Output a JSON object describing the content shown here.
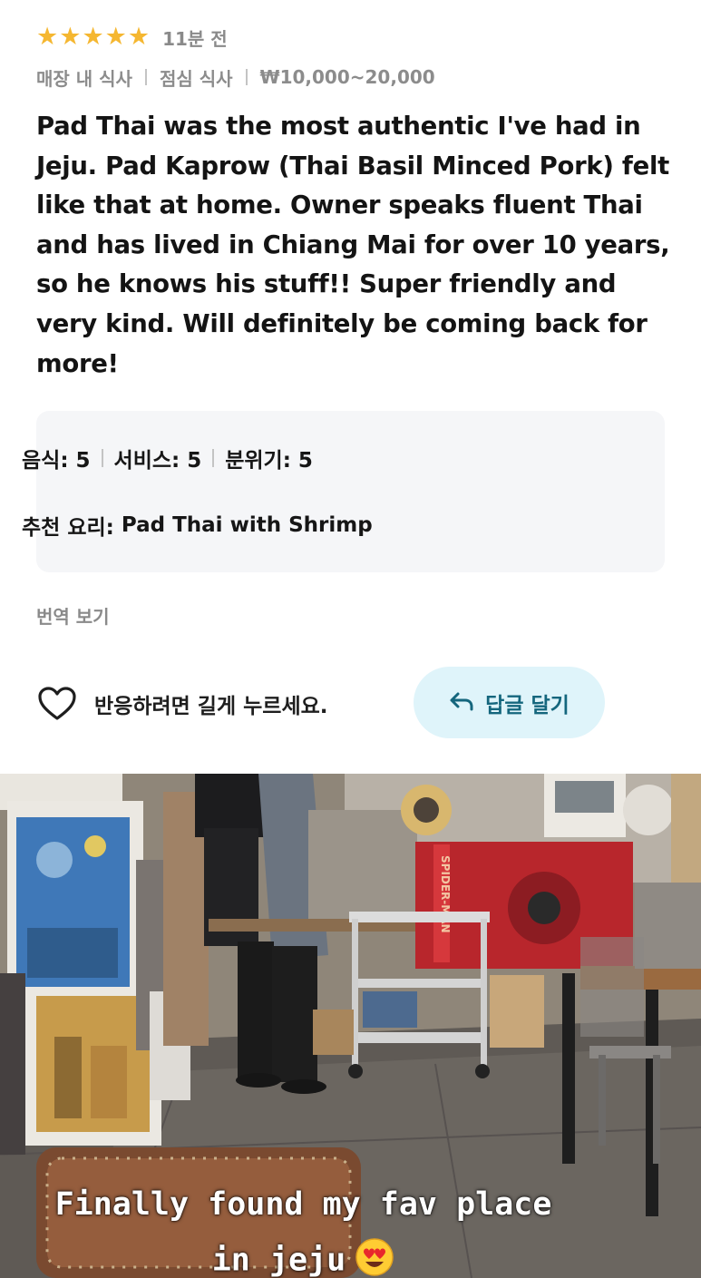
{
  "review": {
    "rating": 5,
    "rating_max": 5,
    "time_ago": "11분 전",
    "meta": {
      "dining_type": "매장 내 식사",
      "meal": "점심 식사",
      "price_range": "₩10,000~20,000"
    },
    "text": "Pad Thai was the most authentic I've had in Jeju. Pad Kaprow (Thai Basil Minced Pork) felt like that at home. Owner speaks fluent Thai and has lived in Chiang Mai for over 10 years, so he knows his stuff!! Super friendly and very kind. Will definitely be coming back for more!",
    "scores": {
      "food": "음식: 5",
      "service": "서비스: 5",
      "atmosphere": "분위기: 5"
    },
    "recommended_label": "추천 요리:",
    "recommended_dish": "Pad Thai with Shrimp",
    "translate_label": "번역 보기",
    "react_hint": "반응하려면 길게 누르세요.",
    "reply_label": "답글 달기"
  },
  "photo": {
    "caption_line1": "Finally found my fav place",
    "caption_line2": "in jeju",
    "sign_text": "SPIDER-MAN"
  },
  "colors": {
    "star": "#f5b731",
    "reply_bg": "#dff4fa",
    "reply_text": "#14667d",
    "summary_bg": "#f5f6f8"
  }
}
